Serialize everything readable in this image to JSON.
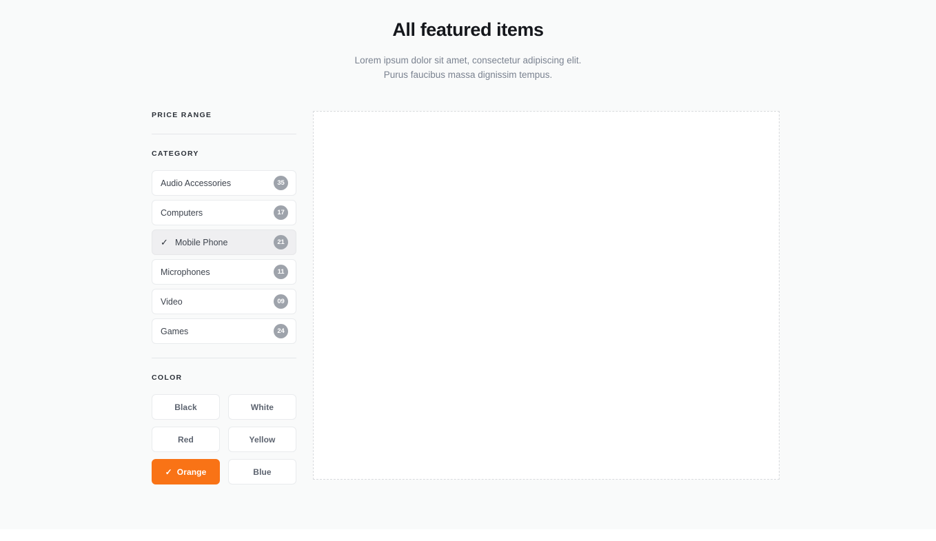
{
  "header": {
    "title": "All featured items",
    "subtitle_line1": "Lorem ipsum dolor sit amet, consectetur adipiscing elit.",
    "subtitle_line2": "Purus faucibus massa dignissim tempus."
  },
  "sidebar": {
    "price_range": {
      "label": "PRICE RANGE"
    },
    "category": {
      "label": "CATEGORY",
      "items": [
        {
          "label": "Audio Accessories",
          "count": "35",
          "selected": false
        },
        {
          "label": "Computers",
          "count": "17",
          "selected": false
        },
        {
          "label": "Mobile Phone",
          "count": "21",
          "selected": true
        },
        {
          "label": "Microphones",
          "count": "11",
          "selected": false
        },
        {
          "label": "Video",
          "count": "09",
          "selected": false
        },
        {
          "label": "Games",
          "count": "24",
          "selected": false
        }
      ]
    },
    "color": {
      "label": "COLOR",
      "items": [
        {
          "label": "Black",
          "selected": false
        },
        {
          "label": "White",
          "selected": false
        },
        {
          "label": "Red",
          "selected": false
        },
        {
          "label": "Yellow",
          "selected": false
        },
        {
          "label": "Orange",
          "selected": true
        },
        {
          "label": "Blue",
          "selected": false
        }
      ]
    }
  },
  "icons": {
    "check": "✓"
  },
  "colors": {
    "accent": "#f97316",
    "badge": "#9ea3ab",
    "page_background": "#f9fafa",
    "panel_border": "#d8dadd"
  },
  "results": {
    "panel_empty": true
  }
}
